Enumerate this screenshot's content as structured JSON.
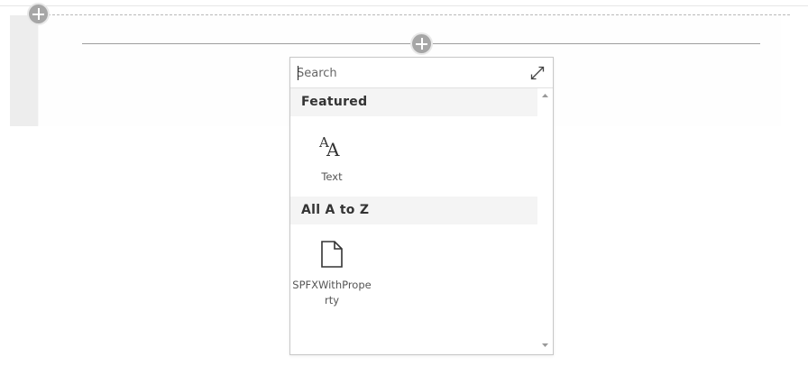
{
  "toolbox": {
    "search_placeholder": "Search",
    "groups": [
      {
        "title": "Featured",
        "items": [
          {
            "label": "Text",
            "icon": "text-icon"
          }
        ]
      },
      {
        "title": "All A to Z",
        "items": [
          {
            "label": "SPFXWithProperty",
            "icon": "document-icon"
          }
        ]
      }
    ]
  },
  "icons": {
    "add_section": "plus-icon",
    "add_webpart": "plus-icon",
    "expand": "expand-icon"
  },
  "colors": {
    "plus_button": "#a6a6a6",
    "group_header_bg": "#f4f4f4",
    "picker_border": "#c8c8c8"
  }
}
